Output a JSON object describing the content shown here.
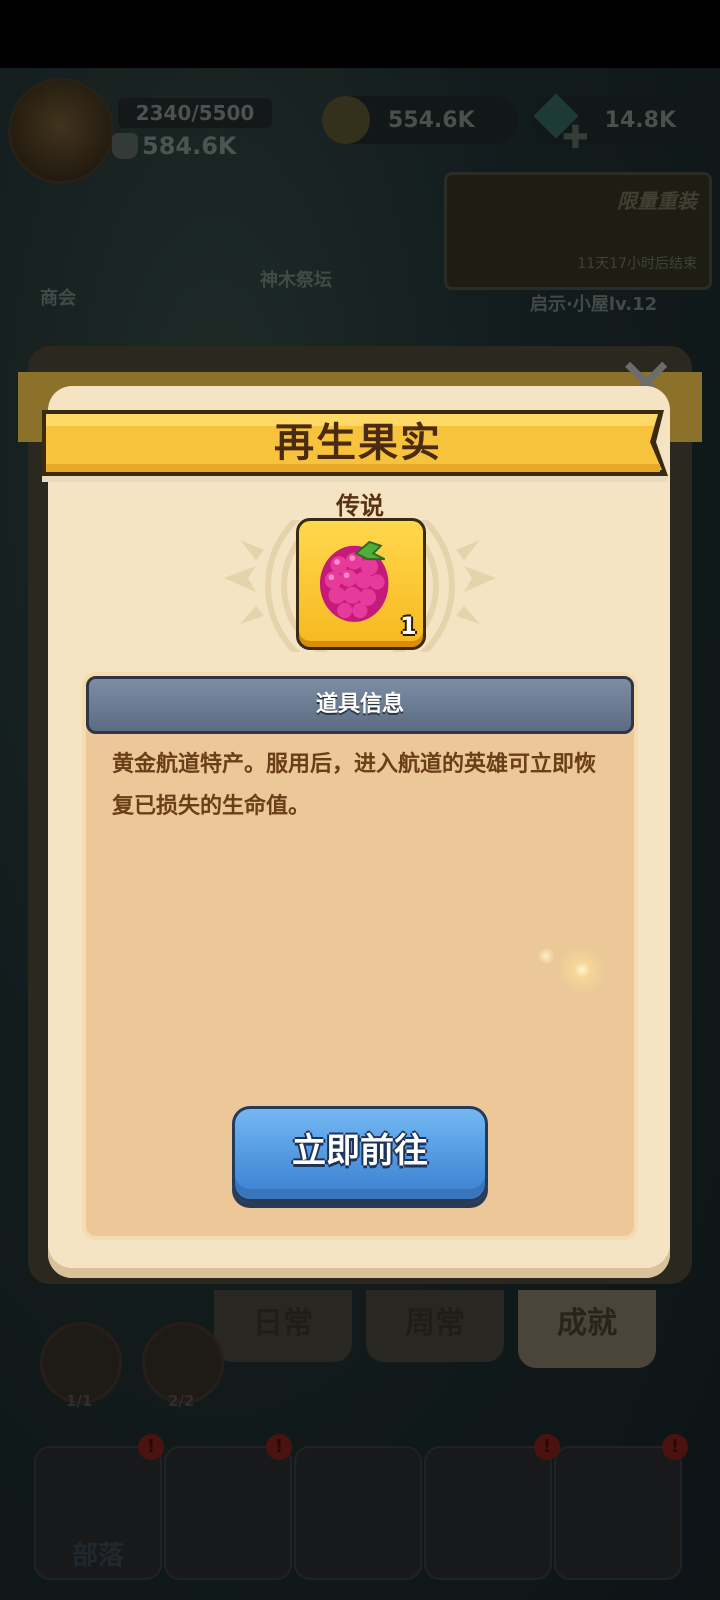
{
  "hud": {
    "exp": "2340/5500",
    "power": "584.6K",
    "coins": "554.6K",
    "gems": "14.8K",
    "event_title": "限量重装",
    "event_time": "11天17小时后结束",
    "shop_label": "商会",
    "altar_label": "神木祭坛",
    "hut_label": "启示·小屋lv.12",
    "bot_left_count": "1/1",
    "bot_mid_count": "2/2",
    "nav_tribe": "部落"
  },
  "under": {
    "title_partial": "成就",
    "tabs": [
      {
        "label": "日常"
      },
      {
        "label": "周常"
      },
      {
        "label": "成就"
      }
    ]
  },
  "modal": {
    "title": "再生果实",
    "rarity": "传说",
    "item_icon": "raspberry-icon",
    "item_qty": "1",
    "info_header": "道具信息",
    "description": "黄金航道特产。服用后，进入航道的英雄可立即恢复已损失的生命值。",
    "go_button": "立即前往"
  },
  "colors": {
    "modal_bg": "#f4e4c3",
    "banner": "#f7c33c",
    "info_header": "#6b7b92",
    "button": "#4f95de",
    "text_brown": "#6a3e18"
  }
}
